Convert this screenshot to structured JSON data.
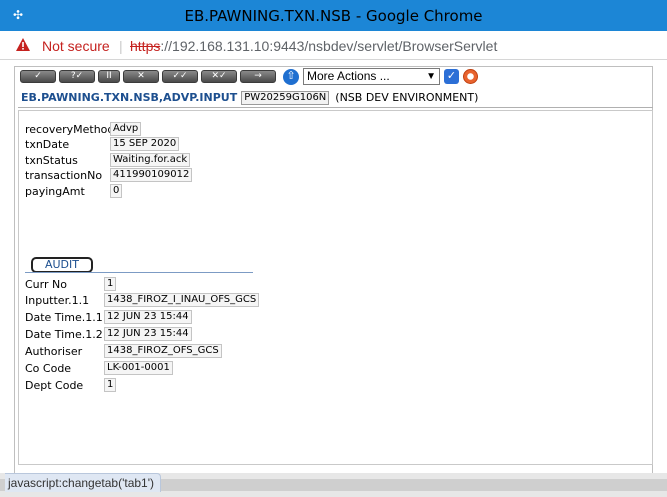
{
  "window": {
    "title": "EB.PAWNING.TXN.NSB - Google Chrome",
    "app_icon": "t24-icon"
  },
  "address_bar": {
    "security_label": "Not secure",
    "url_scheme": "https",
    "url_rest": "://192.168.131.10:9443/nsbdev/servlet/BrowserServlet"
  },
  "toolbar": {
    "buttons": [
      {
        "name": "commit-button",
        "glyph": "✓"
      },
      {
        "name": "validate-button",
        "glyph": "?✓"
      },
      {
        "name": "hold-button",
        "glyph": "II"
      },
      {
        "name": "delete-button",
        "glyph": "✕"
      },
      {
        "name": "authorise-button",
        "glyph": "✓✓"
      },
      {
        "name": "reverse-button",
        "glyph": "✕✓"
      },
      {
        "name": "next-button",
        "glyph": "→"
      }
    ],
    "more_actions_label": "More Actions ..."
  },
  "header": {
    "app_name": "EB.PAWNING.TXN.NSB,ADVP.INPUT",
    "txn_id": "PW20259G106N",
    "environment": "(NSB DEV ENVIRONMENT)"
  },
  "fields": [
    {
      "label": "recoveryMethod",
      "value": "Advp"
    },
    {
      "label": "txnDate",
      "value": "15 SEP 2020"
    },
    {
      "label": "txnStatus",
      "value": "Waiting.for.ack"
    },
    {
      "label": "transactionNo",
      "value": "411990109012"
    },
    {
      "label": "payingAmt",
      "value": "0"
    }
  ],
  "audit_tab_label": "AUDIT",
  "audit_fields": [
    {
      "label": "Curr No",
      "value": "1"
    },
    {
      "label": "Inputter.1.1",
      "value": "1438_FIROZ_I_INAU_OFS_GCS"
    },
    {
      "label": "Date Time.1.1",
      "value": "12 JUN 23 15:44"
    },
    {
      "label": "Date Time.1.2",
      "value": "12 JUN 23 15:44"
    },
    {
      "label": "Authoriser",
      "value": "1438_FIROZ_OFS_GCS"
    },
    {
      "label": "Co Code",
      "value": "LK-001-0001"
    },
    {
      "label": "Dept Code",
      "value": "1"
    }
  ],
  "status_bar": {
    "text": "javascript:changetab('tab1')"
  }
}
